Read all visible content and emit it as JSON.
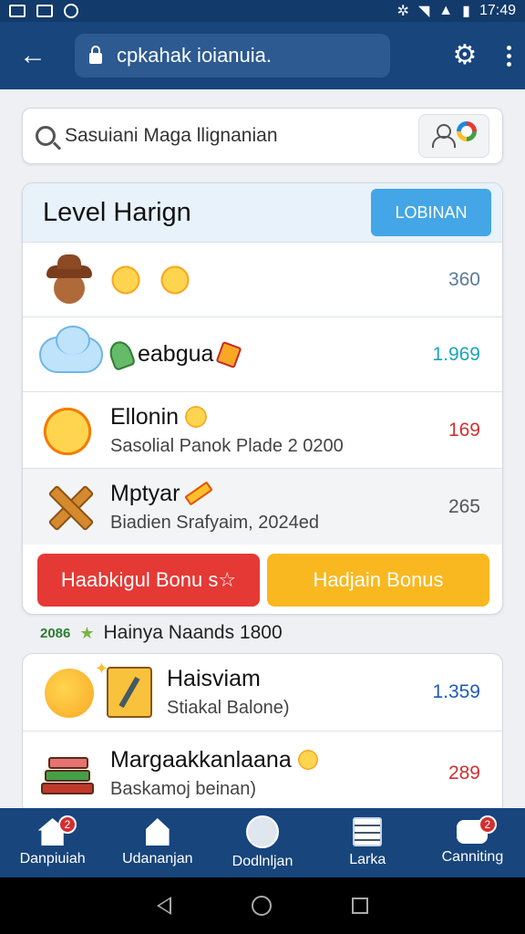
{
  "status_bar": {
    "time": "17:49"
  },
  "app_bar": {
    "url": "cpkahak ioianuia."
  },
  "search": {
    "text": "Sasuiani Maga llignanian"
  },
  "level_card": {
    "title": "Level Harign",
    "login_button": "LOBINAN",
    "rows": [
      {
        "title": "",
        "subtitle": "",
        "value": "360",
        "value_color": "#5b7a99"
      },
      {
        "title": "eabgua",
        "subtitle": "",
        "value": "1.969",
        "value_color": "#19a6b8"
      },
      {
        "title": "Ellonin",
        "subtitle": "Sasolial Panok Plade 2 0200",
        "value": "169",
        "value_color": "#d32f2f"
      },
      {
        "title": "Mptyar",
        "subtitle": "Biadien Srafyaim, 2024ed",
        "value": "265",
        "value_color": "#555555"
      }
    ],
    "bonus_red": "Haabkigul Bonu s☆",
    "bonus_yellow": "Hadjain Bonus"
  },
  "section": {
    "prefix": "2086",
    "label": "Hainya Naands 1800"
  },
  "list_card": {
    "rows": [
      {
        "title": "Haisviam",
        "subtitle": "Stiakal Balone)",
        "value": "1.359",
        "value_color": "#1e5bb8"
      },
      {
        "title": "Margaakkanlaana",
        "subtitle": "Baskamoj beinan)",
        "value": "289",
        "value_color": "#d32f2f"
      }
    ]
  },
  "bottom_nav": [
    {
      "label": "Danpiuiah",
      "badge": "2"
    },
    {
      "label": "Udananjan",
      "badge": ""
    },
    {
      "label": "Dodlnljan",
      "badge": ""
    },
    {
      "label": "Larka",
      "badge": ""
    },
    {
      "label": "Canniting",
      "badge": "2"
    }
  ],
  "icons": {
    "back": "arrow-left-icon",
    "lock": "lock-icon",
    "settings": "gear-icon",
    "more": "more-vert-icon",
    "search": "search-icon"
  }
}
